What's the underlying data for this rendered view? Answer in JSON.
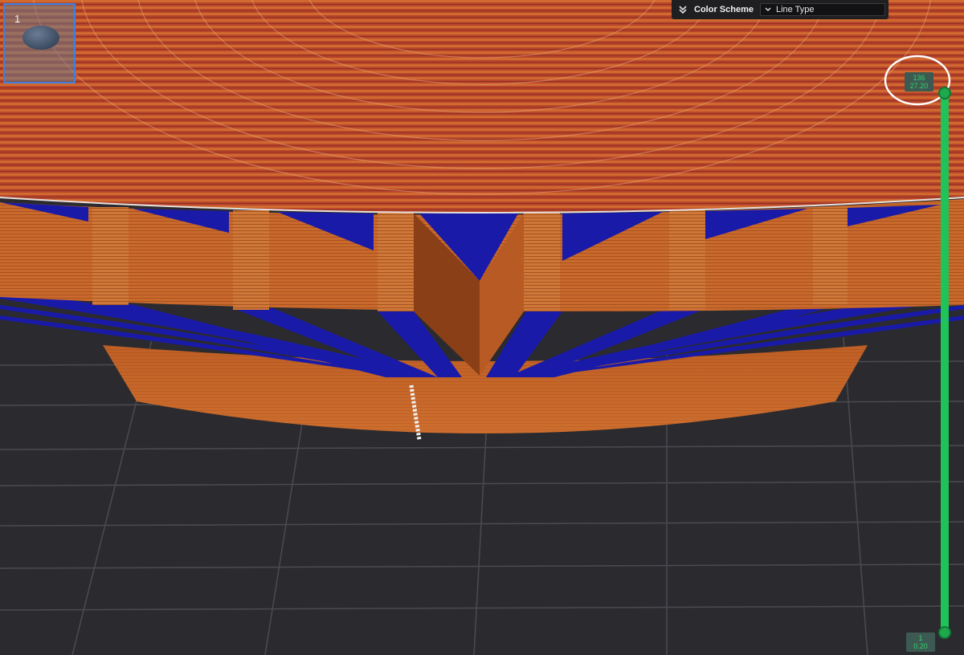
{
  "plate": {
    "number": "1"
  },
  "color_scheme": {
    "label": "Color Scheme",
    "selected": "Line Type"
  },
  "layer_slider": {
    "top": {
      "layer": "136",
      "height": "27.20"
    },
    "bottom": {
      "layer": "1",
      "height": "0.20"
    }
  },
  "colors": {
    "background": "#2b2b2f",
    "wall": "#c8642a",
    "support": "#1818a8",
    "infill": "#b0402a",
    "slider": "#20c25a",
    "annotation": "#ffffff"
  },
  "icons": {
    "collapse": "double-chevron-down-icon",
    "select": "chevron-down-icon"
  }
}
